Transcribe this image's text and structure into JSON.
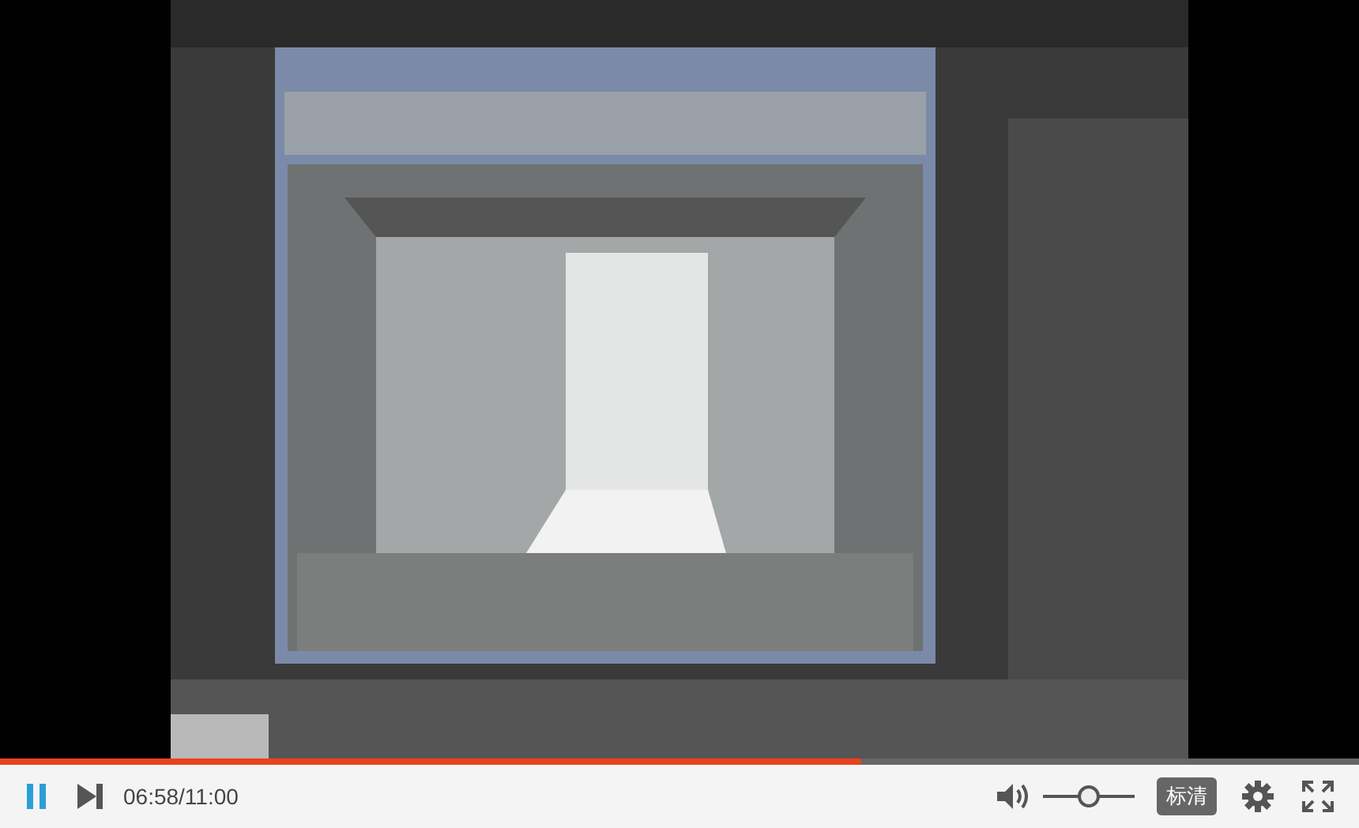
{
  "video": {
    "kind": "picture",
    "playing": true
  },
  "progress": {
    "level": 0.634
  },
  "controls": {
    "time": "06:58/11:00",
    "volume": {
      "level": 0.5
    },
    "quality": "标清"
  }
}
